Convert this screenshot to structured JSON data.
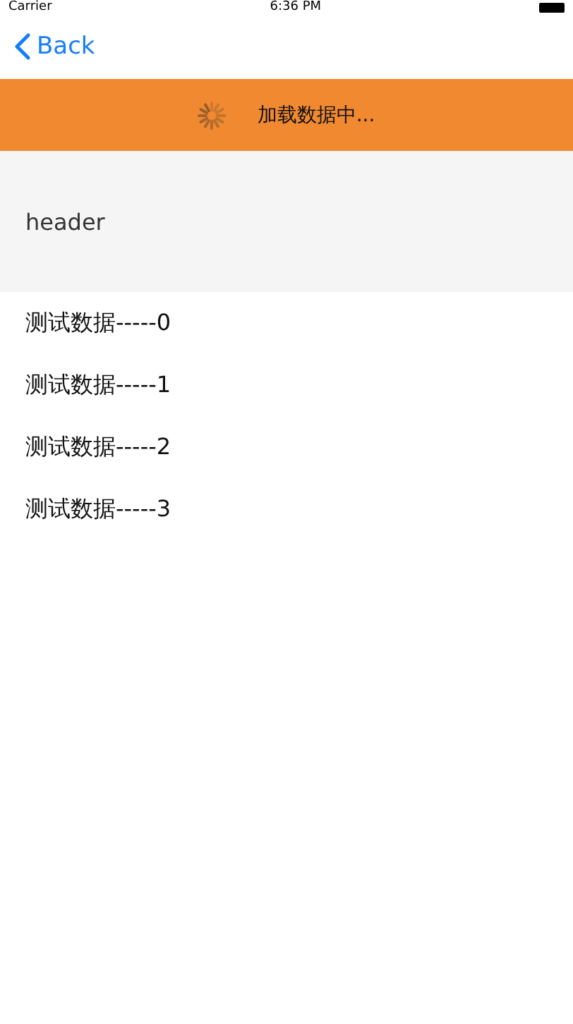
{
  "status_bar": {
    "carrier": "Carrier",
    "time": "6:36 PM"
  },
  "nav": {
    "back": "Back"
  },
  "loading_banner": {
    "text": "加载数据中..."
  },
  "list": {
    "header": "header",
    "rows": [
      "测试数据-----0",
      "测试数据-----1",
      "测试数据-----2",
      "测试数据-----3"
    ]
  }
}
